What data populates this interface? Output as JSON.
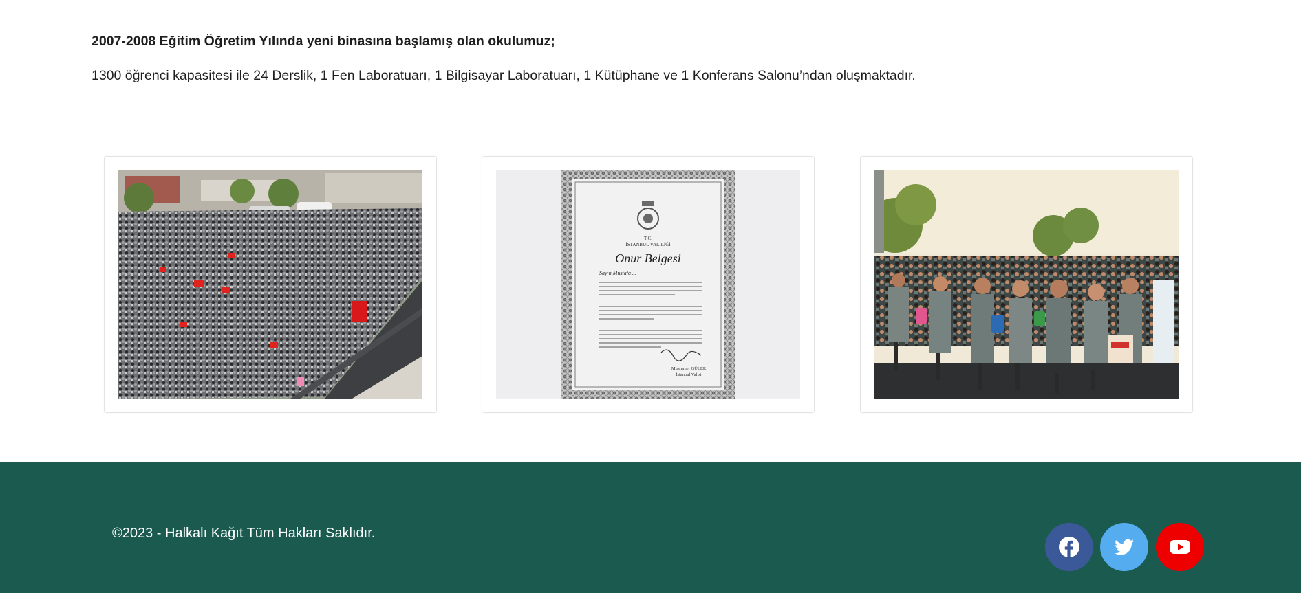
{
  "intro": {
    "lead": "2007-2008 Eğitim Öğretim Yılında yeni binasına başlamış olan okulumuz;",
    "description": "1300 öğrenci kapasitesi ile 24 Derslik, 1 Fen Laboratuarı, 1 Bilgisayar Laboratuarı, 1 Kütüphane ve 1 Konferans Salonu’ndan oluşmaktadır."
  },
  "gallery": {
    "items": [
      {
        "name": "school-ceremony-photo"
      },
      {
        "name": "certificate-photo",
        "certificate": {
          "line1": "T.C.",
          "line2": "İSTANBUL VALİLİĞİ",
          "title": "Onur Belgesi",
          "recipient": "Sayın Mustafa ...",
          "signer": "Muammer GÜLER",
          "signer_title": "İstanbul Valisi"
        }
      },
      {
        "name": "students-lineup-photo"
      }
    ]
  },
  "footer": {
    "copyright": "©2023 - Halkalı Kağıt Tüm Hakları Saklıdır.",
    "social": [
      {
        "name": "facebook-icon",
        "color": "#3b5998"
      },
      {
        "name": "twitter-icon",
        "color": "#55acee"
      },
      {
        "name": "youtube-icon",
        "color": "#ee0000"
      }
    ]
  }
}
